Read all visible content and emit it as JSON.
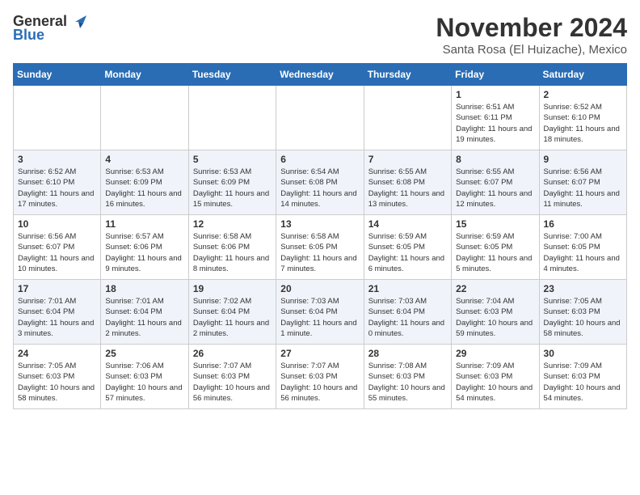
{
  "logo": {
    "line1": "General",
    "line2": "Blue"
  },
  "title": "November 2024",
  "subtitle": "Santa Rosa (El Huizache), Mexico",
  "weekdays": [
    "Sunday",
    "Monday",
    "Tuesday",
    "Wednesday",
    "Thursday",
    "Friday",
    "Saturday"
  ],
  "weeks": [
    [
      {
        "day": "",
        "info": ""
      },
      {
        "day": "",
        "info": ""
      },
      {
        "day": "",
        "info": ""
      },
      {
        "day": "",
        "info": ""
      },
      {
        "day": "",
        "info": ""
      },
      {
        "day": "1",
        "info": "Sunrise: 6:51 AM\nSunset: 6:11 PM\nDaylight: 11 hours and 19 minutes."
      },
      {
        "day": "2",
        "info": "Sunrise: 6:52 AM\nSunset: 6:10 PM\nDaylight: 11 hours and 18 minutes."
      }
    ],
    [
      {
        "day": "3",
        "info": "Sunrise: 6:52 AM\nSunset: 6:10 PM\nDaylight: 11 hours and 17 minutes."
      },
      {
        "day": "4",
        "info": "Sunrise: 6:53 AM\nSunset: 6:09 PM\nDaylight: 11 hours and 16 minutes."
      },
      {
        "day": "5",
        "info": "Sunrise: 6:53 AM\nSunset: 6:09 PM\nDaylight: 11 hours and 15 minutes."
      },
      {
        "day": "6",
        "info": "Sunrise: 6:54 AM\nSunset: 6:08 PM\nDaylight: 11 hours and 14 minutes."
      },
      {
        "day": "7",
        "info": "Sunrise: 6:55 AM\nSunset: 6:08 PM\nDaylight: 11 hours and 13 minutes."
      },
      {
        "day": "8",
        "info": "Sunrise: 6:55 AM\nSunset: 6:07 PM\nDaylight: 11 hours and 12 minutes."
      },
      {
        "day": "9",
        "info": "Sunrise: 6:56 AM\nSunset: 6:07 PM\nDaylight: 11 hours and 11 minutes."
      }
    ],
    [
      {
        "day": "10",
        "info": "Sunrise: 6:56 AM\nSunset: 6:07 PM\nDaylight: 11 hours and 10 minutes."
      },
      {
        "day": "11",
        "info": "Sunrise: 6:57 AM\nSunset: 6:06 PM\nDaylight: 11 hours and 9 minutes."
      },
      {
        "day": "12",
        "info": "Sunrise: 6:58 AM\nSunset: 6:06 PM\nDaylight: 11 hours and 8 minutes."
      },
      {
        "day": "13",
        "info": "Sunrise: 6:58 AM\nSunset: 6:05 PM\nDaylight: 11 hours and 7 minutes."
      },
      {
        "day": "14",
        "info": "Sunrise: 6:59 AM\nSunset: 6:05 PM\nDaylight: 11 hours and 6 minutes."
      },
      {
        "day": "15",
        "info": "Sunrise: 6:59 AM\nSunset: 6:05 PM\nDaylight: 11 hours and 5 minutes."
      },
      {
        "day": "16",
        "info": "Sunrise: 7:00 AM\nSunset: 6:05 PM\nDaylight: 11 hours and 4 minutes."
      }
    ],
    [
      {
        "day": "17",
        "info": "Sunrise: 7:01 AM\nSunset: 6:04 PM\nDaylight: 11 hours and 3 minutes."
      },
      {
        "day": "18",
        "info": "Sunrise: 7:01 AM\nSunset: 6:04 PM\nDaylight: 11 hours and 2 minutes."
      },
      {
        "day": "19",
        "info": "Sunrise: 7:02 AM\nSunset: 6:04 PM\nDaylight: 11 hours and 2 minutes."
      },
      {
        "day": "20",
        "info": "Sunrise: 7:03 AM\nSunset: 6:04 PM\nDaylight: 11 hours and 1 minute."
      },
      {
        "day": "21",
        "info": "Sunrise: 7:03 AM\nSunset: 6:04 PM\nDaylight: 11 hours and 0 minutes."
      },
      {
        "day": "22",
        "info": "Sunrise: 7:04 AM\nSunset: 6:03 PM\nDaylight: 10 hours and 59 minutes."
      },
      {
        "day": "23",
        "info": "Sunrise: 7:05 AM\nSunset: 6:03 PM\nDaylight: 10 hours and 58 minutes."
      }
    ],
    [
      {
        "day": "24",
        "info": "Sunrise: 7:05 AM\nSunset: 6:03 PM\nDaylight: 10 hours and 58 minutes."
      },
      {
        "day": "25",
        "info": "Sunrise: 7:06 AM\nSunset: 6:03 PM\nDaylight: 10 hours and 57 minutes."
      },
      {
        "day": "26",
        "info": "Sunrise: 7:07 AM\nSunset: 6:03 PM\nDaylight: 10 hours and 56 minutes."
      },
      {
        "day": "27",
        "info": "Sunrise: 7:07 AM\nSunset: 6:03 PM\nDaylight: 10 hours and 56 minutes."
      },
      {
        "day": "28",
        "info": "Sunrise: 7:08 AM\nSunset: 6:03 PM\nDaylight: 10 hours and 55 minutes."
      },
      {
        "day": "29",
        "info": "Sunrise: 7:09 AM\nSunset: 6:03 PM\nDaylight: 10 hours and 54 minutes."
      },
      {
        "day": "30",
        "info": "Sunrise: 7:09 AM\nSunset: 6:03 PM\nDaylight: 10 hours and 54 minutes."
      }
    ]
  ]
}
